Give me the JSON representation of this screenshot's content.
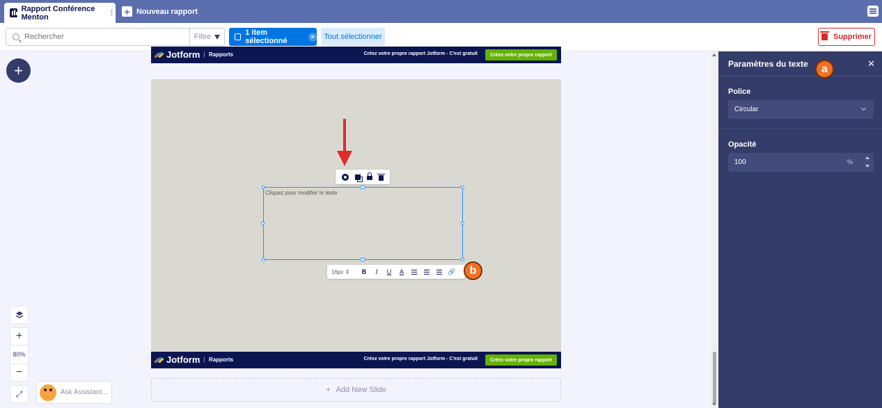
{
  "tabs": {
    "active_label": "Rapport Conférence Menton",
    "new_label": "Nouveau rapport"
  },
  "toolbar": {
    "search_placeholder": "Rechercher",
    "filter_label": "Filtre",
    "selected_label": "1 item sélectionné",
    "select_all_label": "Tout sélectionner",
    "delete_label": "Supprimer"
  },
  "report": {
    "brand": "Jotform",
    "section": "Rapports",
    "cta_text": "Créez votre propre rapport Jotform - C'est gratuit",
    "cta_button": "Créez votre propre rapport"
  },
  "slide": {
    "text_placeholder": "Cliquez pour modifier le texte",
    "font_size": "16px",
    "fmt": {
      "bold": "B",
      "italic": "I",
      "underline": "U",
      "color": "A"
    }
  },
  "badges": {
    "a": "a",
    "b": "b"
  },
  "canvas": {
    "zoom_level": "80%",
    "add_slide_label": "Add New Slide",
    "assistant_label": "Ask Assistant..."
  },
  "panel": {
    "title": "Paramètres du texte",
    "font_label": "Police",
    "font_value": "Circular",
    "opacity_label": "Opacité",
    "opacity_value": "100",
    "opacity_unit": "%"
  },
  "colors": {
    "topbar": "#5b6eae",
    "navy": "#0a1551",
    "accent_blue": "#0075e3",
    "danger": "#dc2626",
    "cta_green": "#64b200",
    "badge_orange": "#f37021",
    "arrow_red": "#e22b2b",
    "panel_bg": "#343c6a"
  }
}
